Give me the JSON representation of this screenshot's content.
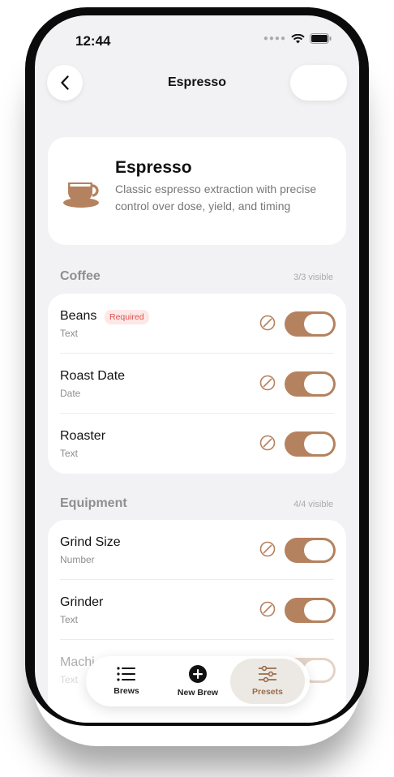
{
  "status": {
    "time": "12:44"
  },
  "nav": {
    "title": "Espresso"
  },
  "preset": {
    "title": "Espresso",
    "description": "Classic espresso extraction with precise control over dose, yield, and timing"
  },
  "sections": [
    {
      "title": "Coffee",
      "count": "3/3 visible",
      "rows": [
        {
          "label": "Beans",
          "type": "Text",
          "badge": "Required",
          "enabled": true
        },
        {
          "label": "Roast Date",
          "type": "Date",
          "enabled": true
        },
        {
          "label": "Roaster",
          "type": "Text",
          "enabled": true
        }
      ]
    },
    {
      "title": "Equipment",
      "count": "4/4 visible",
      "rows": [
        {
          "label": "Grind Size",
          "type": "Number",
          "enabled": true
        },
        {
          "label": "Grinder",
          "type": "Text",
          "enabled": true
        },
        {
          "label": "Machi",
          "type": "Text",
          "enabled": true
        }
      ]
    }
  ],
  "tabbar": {
    "tabs": [
      {
        "label": "Brews",
        "icon": "list-icon"
      },
      {
        "label": "New Brew",
        "icon": "plus-circle-icon"
      },
      {
        "label": "Presets",
        "icon": "sliders-icon",
        "active": true
      }
    ]
  },
  "colors": {
    "accent": "#b5825f",
    "background": "#f2f2f4",
    "required": "#d9534f"
  }
}
